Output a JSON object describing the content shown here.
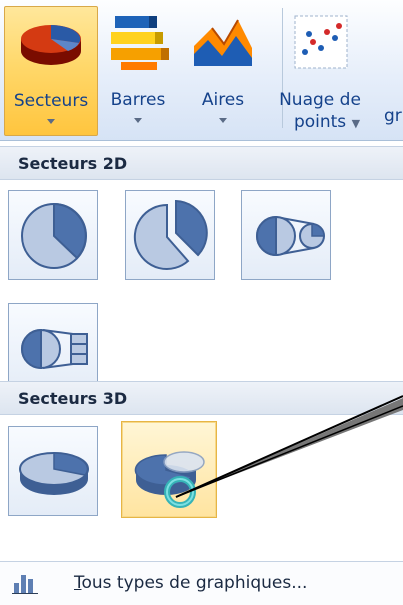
{
  "ribbon": {
    "buttons": [
      {
        "label": "Secteurs",
        "icon": "pie-chart-icon"
      },
      {
        "label": "Barres",
        "icon": "bar-chart-icon"
      },
      {
        "label": "Aires",
        "icon": "area-chart-icon"
      },
      {
        "label": "Nuage de",
        "label2": "points",
        "icon": "scatter-chart-icon"
      }
    ],
    "clipped_label": "gr"
  },
  "gallery": {
    "section_2d": "Secteurs 2D",
    "section_3d": "Secteurs 3D",
    "tiles_2d": [
      "pie-2d-icon",
      "exploded-pie-2d-icon",
      "pie-of-pie-icon",
      "bar-of-pie-icon"
    ],
    "tiles_3d": [
      "pie-3d-icon",
      "exploded-pie-3d-icon"
    ]
  },
  "footer": {
    "label": "Tous types de graphiques..."
  },
  "colors": {
    "active_highlight": "#ffd86b",
    "header_text": "#15428b",
    "pie_blue": "#4a6fa8"
  }
}
